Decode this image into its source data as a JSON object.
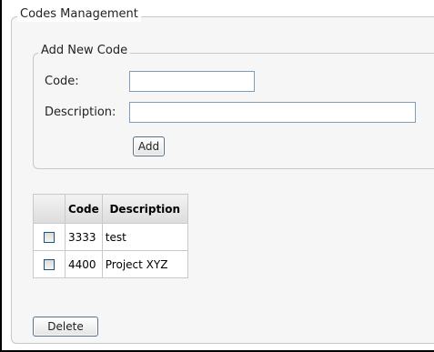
{
  "codes_management": {
    "legend": "Codes Management",
    "add_new": {
      "legend": "Add New Code",
      "code_label": "Code:",
      "code_value": "",
      "description_label": "Description:",
      "description_value": "",
      "add_button": "Add"
    },
    "table": {
      "headers": [
        "",
        "Code",
        "Description"
      ],
      "rows": [
        {
          "code": "3333",
          "description": "test"
        },
        {
          "code": "4400",
          "description": "Project XYZ"
        }
      ]
    },
    "delete_button": "Delete"
  }
}
